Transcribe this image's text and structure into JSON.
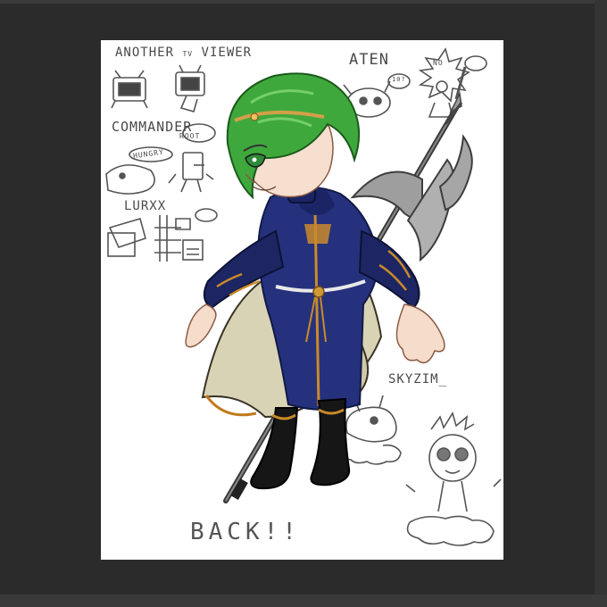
{
  "doodle_labels": {
    "another": "ANOTHER",
    "tv": "TV",
    "viewer": "VIEWER",
    "aten": "ATEN",
    "commander": "COMMANDER",
    "root": "ROOT",
    "hungry": "HUNGRY",
    "lurxx": "LURXX",
    "skyzim": "SKYZIM_",
    "back": "BACK!!",
    "no": "NO",
    "ten": "10?"
  },
  "colors": {
    "background": "#2b2b2b",
    "canvas": "#ffffff",
    "hair": "#3fa83c",
    "coat": "#24307a",
    "gold": "#c98a2a",
    "boots": "#151515",
    "cape": "#d8d2b8",
    "skin": "#f6dccb",
    "weapon": "#6c6c6c"
  }
}
